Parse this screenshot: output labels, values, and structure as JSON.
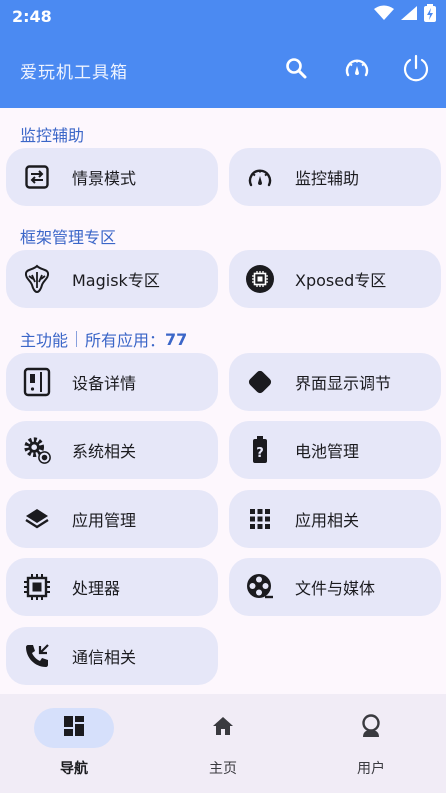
{
  "status_bar": {
    "time": "2:48"
  },
  "app_bar": {
    "title": "爱玩机工具箱"
  },
  "sections": {
    "monitor": {
      "title": "监控辅助"
    },
    "framework": {
      "title": "框架管理专区"
    },
    "main": {
      "title": "主功能",
      "all_apps_label": "所有应用：",
      "all_apps_count": "77"
    }
  },
  "cards": {
    "scene_mode": "情景模式",
    "monitor_assist": "监控辅助",
    "magisk": "Magisk专区",
    "xposed": "Xposed专区",
    "device_details": "设备详情",
    "display_adjust": "界面显示调节",
    "system": "系统相关",
    "battery": "电池管理",
    "app_manage": "应用管理",
    "app_related": "应用相关",
    "processor": "处理器",
    "files_media": "文件与媒体",
    "telecom": "通信相关"
  },
  "bottom_nav": {
    "items": [
      {
        "label": "导航"
      },
      {
        "label": "主页"
      },
      {
        "label": "用户"
      }
    ]
  },
  "colors": {
    "app_bar": "#4b8af2",
    "card": "#e6e7f8",
    "section_title": "#3b66c8",
    "background": "#fdf7fd",
    "nav_active": "#d6e0fb"
  }
}
